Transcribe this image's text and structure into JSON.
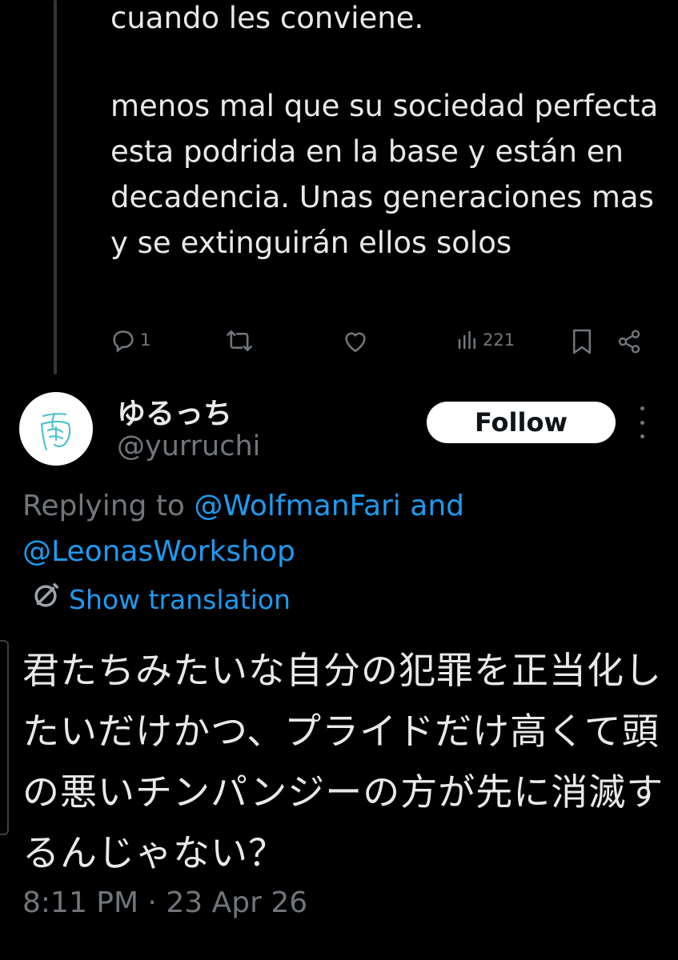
{
  "previous_tweet": {
    "text_line_1": "cuando les conviene.",
    "text_paragraph_2": "menos mal que su sociedad perfecta esta podrida en la base y están en decadencia. Unas generaciones mas y se extinguirán ellos solos",
    "reply_count": "1",
    "view_count": "221"
  },
  "reply": {
    "display_name": "ゆるっち",
    "handle": "@yurruchi",
    "follow_label": "Follow",
    "replying_prefix": "Replying to ",
    "replying_to_1": "@WolfmanFari",
    "replying_and": " and",
    "replying_to_2": "@LeonasWorkshop",
    "show_translation": "Show translation",
    "text_lines": [
      "君たちみたいな自分の犯罪を正当化し",
      "たいだけかつ、プライドだけ高くて頭",
      "の悪いチンパンジーの方が先に消滅す",
      "るんじゃない？"
    ],
    "timestamp": "8:11 PM · 23 Apr 26"
  },
  "icons": {
    "reply": "reply-icon",
    "retweet": "retweet-icon",
    "like": "heart-icon",
    "views": "views-chart-icon",
    "bookmark": "bookmark-icon",
    "share": "share-icon",
    "translate": "translate-globe-icon",
    "more": "more-dots-icon"
  },
  "colors": {
    "background": "#000000",
    "text": "#e7e9ea",
    "muted": "#71767b",
    "link": "#1d9bf0"
  }
}
